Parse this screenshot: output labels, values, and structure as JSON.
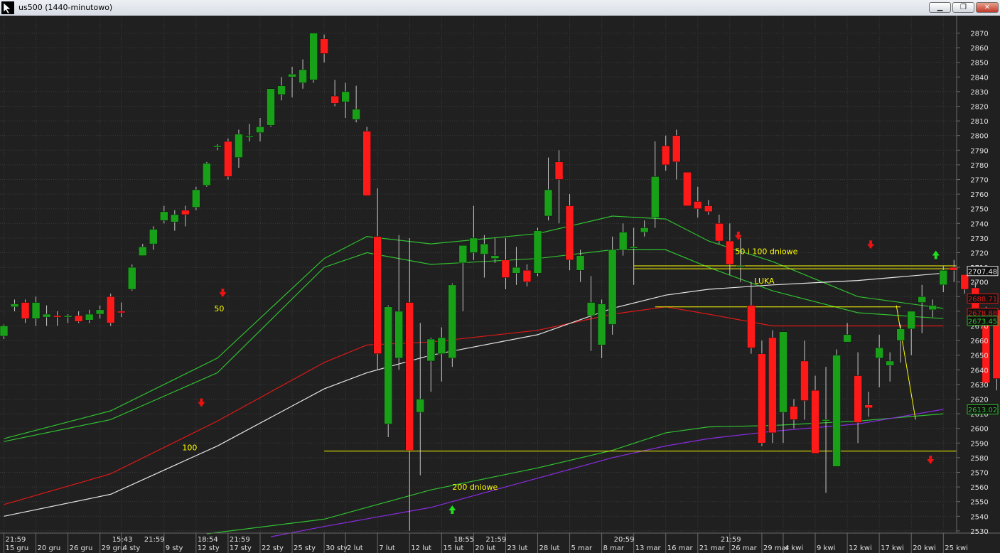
{
  "window": {
    "title": "us500 (1440-minutowo)",
    "minimize_label": "▁",
    "maximize_label": "❐",
    "close_label": "✕"
  },
  "colors": {
    "background": "#202020",
    "grid": "#3a3a3a",
    "up_candle": "#19a019",
    "down_candle": "#ff1a1a",
    "wick": "#c8c8c8",
    "axis_text": "#e0e0e0",
    "annotation": "#ffff00",
    "ma_white": "#e6e6e6",
    "ma_red": "#e01818",
    "ma_green": "#30c030",
    "ma_purple": "#8a2be2",
    "arrow_up": "#22dd22",
    "arrow_down": "#ee1111"
  },
  "chart_data": {
    "type": "candlestick",
    "symbol": "us500",
    "interval": "1440-minutowo",
    "ylim": [
      2526,
      2880
    ],
    "y_ticks": [
      2530,
      2540,
      2550,
      2560,
      2570,
      2580,
      2590,
      2600,
      2610,
      2620,
      2630,
      2640,
      2650,
      2660,
      2670,
      2680,
      2690,
      2700,
      2710,
      2720,
      2730,
      2740,
      2750,
      2760,
      2770,
      2780,
      2790,
      2800,
      2810,
      2820,
      2830,
      2840,
      2850,
      2860,
      2870
    ],
    "x_date_labels": [
      {
        "i": 0,
        "label": "15 gru"
      },
      {
        "i": 3,
        "label": "20 gru"
      },
      {
        "i": 6,
        "label": "26 gru"
      },
      {
        "i": 9,
        "label": "29 gru"
      },
      {
        "i": 11,
        "label": "4 sty"
      },
      {
        "i": 15,
        "label": "9 sty"
      },
      {
        "i": 18,
        "label": "12 sty"
      },
      {
        "i": 21,
        "label": "17 sty"
      },
      {
        "i": 24,
        "label": "22 sty"
      },
      {
        "i": 27,
        "label": "25 sty"
      },
      {
        "i": 30,
        "label": "30 sty"
      },
      {
        "i": 32,
        "label": "2 lut"
      },
      {
        "i": 35,
        "label": "7 lut"
      },
      {
        "i": 38,
        "label": "12 lut"
      },
      {
        "i": 41,
        "label": "15 lut"
      },
      {
        "i": 44,
        "label": "20 lut"
      },
      {
        "i": 47,
        "label": "23 lut"
      },
      {
        "i": 50,
        "label": "28 lut"
      },
      {
        "i": 53,
        "label": "5 mar"
      },
      {
        "i": 56,
        "label": "8 mar"
      },
      {
        "i": 59,
        "label": "13 mar"
      },
      {
        "i": 62,
        "label": "16 mar"
      },
      {
        "i": 65,
        "label": "21 mar"
      },
      {
        "i": 68,
        "label": "26 mar"
      },
      {
        "i": 71,
        "label": "29 mar"
      },
      {
        "i": 73,
        "label": "4 kwi"
      },
      {
        "i": 76,
        "label": "9 kwi"
      },
      {
        "i": 79,
        "label": "12 kwi"
      },
      {
        "i": 82,
        "label": "17 kwi"
      },
      {
        "i": 85,
        "label": "20 kwi"
      },
      {
        "i": 88,
        "label": "25 kwi"
      }
    ],
    "x_time_labels": [
      {
        "i": 0,
        "label": "21:59"
      },
      {
        "i": 10,
        "label": "15:43"
      },
      {
        "i": 13,
        "label": "21:59"
      },
      {
        "i": 18,
        "label": "18:54"
      },
      {
        "i": 21,
        "label": "21:59"
      },
      {
        "i": 42,
        "label": "18:55"
      },
      {
        "i": 45,
        "label": "21:59"
      },
      {
        "i": 57,
        "label": "20:59"
      },
      {
        "i": 67,
        "label": "21:59"
      }
    ],
    "candles": [
      [
        2663,
        2671,
        2661,
        2670
      ],
      [
        2683,
        2688,
        2680,
        2685
      ],
      [
        2686,
        2688,
        2672,
        2675
      ],
      [
        2675,
        2690,
        2670,
        2686
      ],
      [
        2676,
        2684,
        2670,
        2678
      ],
      [
        2677,
        2680,
        2670,
        2676
      ],
      [
        2676,
        2678,
        2672,
        2677
      ],
      [
        2677,
        2680,
        2672,
        2673
      ],
      [
        2674,
        2681,
        2672,
        2678
      ],
      [
        2678,
        2684,
        2675,
        2681
      ],
      [
        2690,
        2692,
        2670,
        2672
      ],
      [
        2680,
        2686,
        2676,
        2679
      ],
      [
        2695,
        2712,
        2694,
        2710
      ],
      [
        2718,
        2726,
        2718,
        2724
      ],
      [
        2726,
        2738,
        2722,
        2736
      ],
      [
        2742,
        2752,
        2740,
        2748
      ],
      [
        2741,
        2749,
        2735,
        2746
      ],
      [
        2749,
        2752,
        2738,
        2746
      ],
      [
        2751,
        2765,
        2749,
        2763
      ],
      [
        2766,
        2782,
        2765,
        2781
      ],
      [
        2792,
        2794,
        2790,
        2793
      ],
      [
        2796,
        2798,
        2770,
        2772
      ],
      [
        2785,
        2804,
        2778,
        2801
      ],
      [
        2800,
        2808,
        2796,
        2800
      ],
      [
        2802,
        2812,
        2796,
        2806
      ],
      [
        2807,
        2832,
        2806,
        2832
      ],
      [
        2828,
        2840,
        2824,
        2834
      ],
      [
        2840,
        2847,
        2826,
        2842
      ],
      [
        2836,
        2852,
        2832,
        2845
      ],
      [
        2838,
        2870,
        2836,
        2870
      ],
      [
        2866,
        2869,
        2850,
        2856
      ],
      [
        2827,
        2838,
        2820,
        2822
      ],
      [
        2823,
        2836,
        2812,
        2830
      ],
      [
        2811,
        2834,
        2809,
        2818
      ],
      [
        2803,
        2806,
        2779,
        2759
      ],
      [
        2731,
        2764,
        2640,
        2651
      ],
      [
        2603,
        2684,
        2594,
        2683
      ],
      [
        2648,
        2732,
        2640,
        2680
      ],
      [
        2686,
        2730,
        2530,
        2585
      ],
      [
        2611,
        2672,
        2568,
        2620
      ],
      [
        2646,
        2662,
        2625,
        2661
      ],
      [
        2651,
        2669,
        2632,
        2662
      ],
      [
        2648,
        2699,
        2642,
        2698
      ],
      [
        2713,
        2722,
        2680,
        2725
      ],
      [
        2720,
        2752,
        2715,
        2730
      ],
      [
        2719,
        2732,
        2703,
        2726
      ],
      [
        2716,
        2730,
        2713,
        2718
      ],
      [
        2715,
        2730,
        2695,
        2703
      ],
      [
        2706,
        2724,
        2698,
        2710
      ],
      [
        2708,
        2712,
        2697,
        2700
      ],
      [
        2706,
        2737,
        2704,
        2735
      ],
      [
        2745,
        2785,
        2742,
        2763
      ],
      [
        2782,
        2790,
        2740,
        2770
      ],
      [
        2752,
        2760,
        2708,
        2715
      ],
      [
        2708,
        2722,
        2700,
        2718
      ],
      [
        2677,
        2704,
        2653,
        2686
      ],
      [
        2657,
        2688,
        2648,
        2685
      ],
      [
        2671,
        2731,
        2664,
        2722
      ],
      [
        2722,
        2740,
        2718,
        2734
      ],
      [
        2723,
        2737,
        2698,
        2724
      ],
      [
        2734,
        2742,
        2731,
        2737
      ],
      [
        2744,
        2796,
        2737,
        2772
      ],
      [
        2793,
        2800,
        2776,
        2780
      ],
      [
        2800,
        2804,
        2770,
        2782
      ],
      [
        2775,
        2766,
        2760,
        2752
      ],
      [
        2755,
        2765,
        2744,
        2750
      ],
      [
        2752,
        2756,
        2746,
        2748
      ],
      [
        2740,
        2746,
        2726,
        2728
      ],
      [
        2728,
        2740,
        2705,
        2712
      ],
      [
        2711,
        2730,
        2700,
        2711
      ],
      [
        2684,
        2700,
        2651,
        2655
      ],
      [
        2651,
        2660,
        2588,
        2590
      ],
      [
        2662,
        2667,
        2590,
        2597
      ],
      [
        2611,
        2666,
        2590,
        2666
      ],
      [
        2615,
        2620,
        2600,
        2606
      ],
      [
        2646,
        2660,
        2606,
        2619
      ],
      [
        2626,
        2636,
        2583,
        2583
      ],
      [
        2606,
        2642,
        2556,
        2606
      ],
      [
        2574,
        2654,
        2574,
        2650
      ],
      [
        2659,
        2672,
        2660,
        2664
      ],
      [
        2636,
        2652,
        2590,
        2604
      ],
      [
        2616,
        2625,
        2608,
        2614
      ],
      [
        2648,
        2664,
        2628,
        2655
      ],
      [
        2643,
        2652,
        2632,
        2646
      ],
      [
        2660,
        2671,
        2645,
        2668
      ],
      [
        2668,
        2676,
        2650,
        2680
      ],
      [
        2686,
        2698,
        2665,
        2690
      ],
      [
        2681,
        2688,
        2676,
        2684
      ],
      [
        2698,
        2711,
        2693,
        2708
      ],
      [
        2710,
        2715,
        2700,
        2708
      ],
      [
        2705,
        2702,
        2692,
        2695
      ],
      [
        2696,
        2700,
        2672,
        2673
      ],
      [
        2678,
        2683,
        2632,
        2631
      ],
      [
        2681,
        2640,
        2626,
        2634
      ],
      [
        2653,
        2676,
        2647,
        2670
      ]
    ],
    "moving_averages": [
      {
        "color_key": "ma_green",
        "points": [
          [
            0,
            2593
          ],
          [
            10,
            2612
          ],
          [
            20,
            2648
          ],
          [
            30,
            2716
          ],
          [
            34,
            2731
          ],
          [
            40,
            2726
          ],
          [
            50,
            2733
          ],
          [
            57,
            2745
          ],
          [
            62,
            2743
          ],
          [
            66,
            2728
          ],
          [
            72,
            2714
          ],
          [
            80,
            2690
          ],
          [
            88,
            2682
          ]
        ]
      },
      {
        "color_key": "ma_green",
        "points": [
          [
            0,
            2591
          ],
          [
            10,
            2606
          ],
          [
            20,
            2638
          ],
          [
            30,
            2710
          ],
          [
            34,
            2720
          ],
          [
            40,
            2712
          ],
          [
            50,
            2716
          ],
          [
            57,
            2722
          ],
          [
            62,
            2722
          ],
          [
            66,
            2710
          ],
          [
            72,
            2694
          ],
          [
            80,
            2679
          ],
          [
            88,
            2675
          ]
        ]
      },
      {
        "color_key": "ma_red",
        "points": [
          [
            0,
            2548
          ],
          [
            10,
            2569
          ],
          [
            20,
            2605
          ],
          [
            30,
            2645
          ],
          [
            34,
            2657
          ],
          [
            40,
            2659
          ],
          [
            50,
            2667
          ],
          [
            57,
            2678
          ],
          [
            62,
            2683
          ],
          [
            66,
            2678
          ],
          [
            72,
            2670
          ],
          [
            80,
            2670
          ],
          [
            88,
            2670
          ]
        ]
      },
      {
        "color_key": "ma_white",
        "points": [
          [
            0,
            2540
          ],
          [
            10,
            2555
          ],
          [
            20,
            2588
          ],
          [
            30,
            2627
          ],
          [
            34,
            2638
          ],
          [
            40,
            2650
          ],
          [
            50,
            2664
          ],
          [
            57,
            2682
          ],
          [
            62,
            2691
          ],
          [
            66,
            2695
          ],
          [
            72,
            2698
          ],
          [
            80,
            2701
          ],
          [
            88,
            2706
          ]
        ]
      },
      {
        "color_key": "ma_green",
        "points": [
          [
            19,
            2528
          ],
          [
            30,
            2538
          ],
          [
            40,
            2558
          ],
          [
            50,
            2573
          ],
          [
            57,
            2585
          ],
          [
            62,
            2597
          ],
          [
            66,
            2601
          ],
          [
            72,
            2602
          ],
          [
            80,
            2605
          ],
          [
            88,
            2610
          ]
        ]
      },
      {
        "color_key": "ma_purple",
        "points": [
          [
            25,
            2526
          ],
          [
            30,
            2533
          ],
          [
            40,
            2546
          ],
          [
            50,
            2566
          ],
          [
            57,
            2580
          ],
          [
            62,
            2588
          ],
          [
            66,
            2593
          ],
          [
            72,
            2598
          ],
          [
            80,
            2603
          ],
          [
            88,
            2613
          ]
        ]
      }
    ],
    "horizontal_lines": [
      {
        "y": 2584.5,
        "from": 30,
        "to": 92
      },
      {
        "y": 2711,
        "from": 59,
        "to": 92
      },
      {
        "y": 2709,
        "from": 59,
        "to": 92
      },
      {
        "y": 2683,
        "from": 61,
        "to": 84
      }
    ],
    "trend_lines": [
      {
        "x1": 83.6,
        "y1": 2684,
        "x2": 85.4,
        "y2": 2606
      }
    ],
    "annotations": [
      {
        "text": "50",
        "i": 19.7,
        "y": 2680
      },
      {
        "text": "100",
        "i": 16.7,
        "y": 2585
      },
      {
        "text": "50 i 100 dniowe",
        "i": 68.5,
        "y": 2719
      },
      {
        "text": "LUKA",
        "i": 70.3,
        "y": 2699
      },
      {
        "text": "200 dniowe",
        "i": 42.0,
        "y": 2558
      }
    ],
    "arrows": [
      {
        "dir": "down",
        "i": 20.5,
        "y": 2692
      },
      {
        "dir": "down",
        "i": 18.5,
        "y": 2617
      },
      {
        "dir": "up",
        "i": 42.0,
        "y": 2545
      },
      {
        "dir": "down",
        "i": 68.8,
        "y": 2731
      },
      {
        "dir": "down",
        "i": 81.2,
        "y": 2725
      },
      {
        "dir": "up",
        "i": 87.3,
        "y": 2719
      },
      {
        "dir": "down",
        "i": 86.8,
        "y": 2578
      }
    ],
    "price_tags": [
      {
        "label": "2707.48",
        "y": 2707.5,
        "color_key": "ma_white"
      },
      {
        "label": "2688.71",
        "y": 2688.7,
        "color_key": "ma_red"
      },
      {
        "label": "2678.88",
        "y": 2678.9,
        "color_key": "ma_red"
      },
      {
        "label": "2673.45",
        "y": 2673.5,
        "color_key": "ma_green"
      },
      {
        "label": "2613.02",
        "y": 2613.0,
        "color_key": "ma_green"
      }
    ]
  }
}
